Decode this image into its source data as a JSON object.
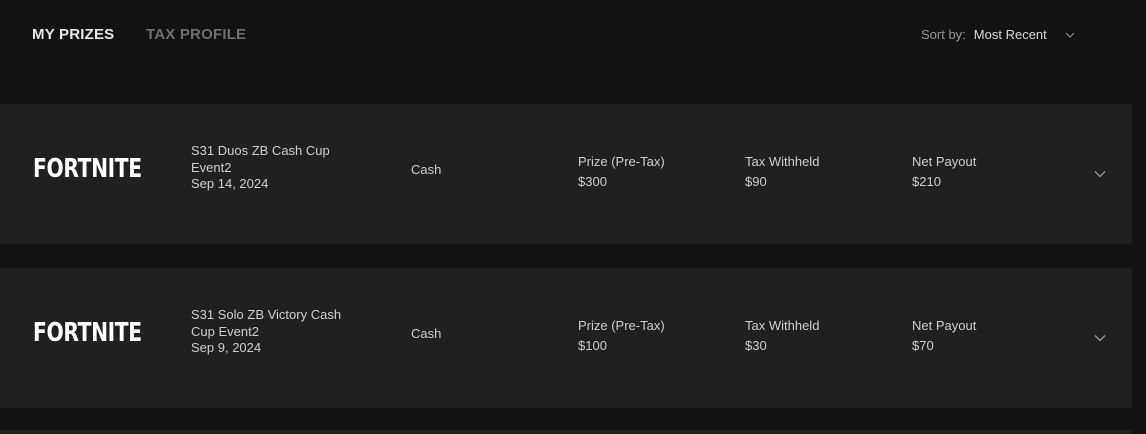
{
  "tabs": {
    "my_prizes": "MY PRIZES",
    "tax_profile": "TAX PROFILE"
  },
  "sort": {
    "label": "Sort by:",
    "value": "Most Recent"
  },
  "prizes": [
    {
      "game": "FORTNITE",
      "event_name": "S31 Duos ZB Cash Cup Event2",
      "date": "Sep 14, 2024",
      "type": "Cash",
      "prize_label": "Prize (Pre-Tax)",
      "prize_value": "$300",
      "tax_label": "Tax Withheld",
      "tax_value": "$90",
      "net_label": "Net Payout",
      "net_value": "$210"
    },
    {
      "game": "FORTNITE",
      "event_name": "S31 Solo ZB Victory Cash Cup Event2",
      "date": "Sep 9, 2024",
      "type": "Cash",
      "prize_label": "Prize (Pre-Tax)",
      "prize_value": "$100",
      "tax_label": "Tax Withheld",
      "tax_value": "$30",
      "net_label": "Net Payout",
      "net_value": "$70"
    }
  ]
}
